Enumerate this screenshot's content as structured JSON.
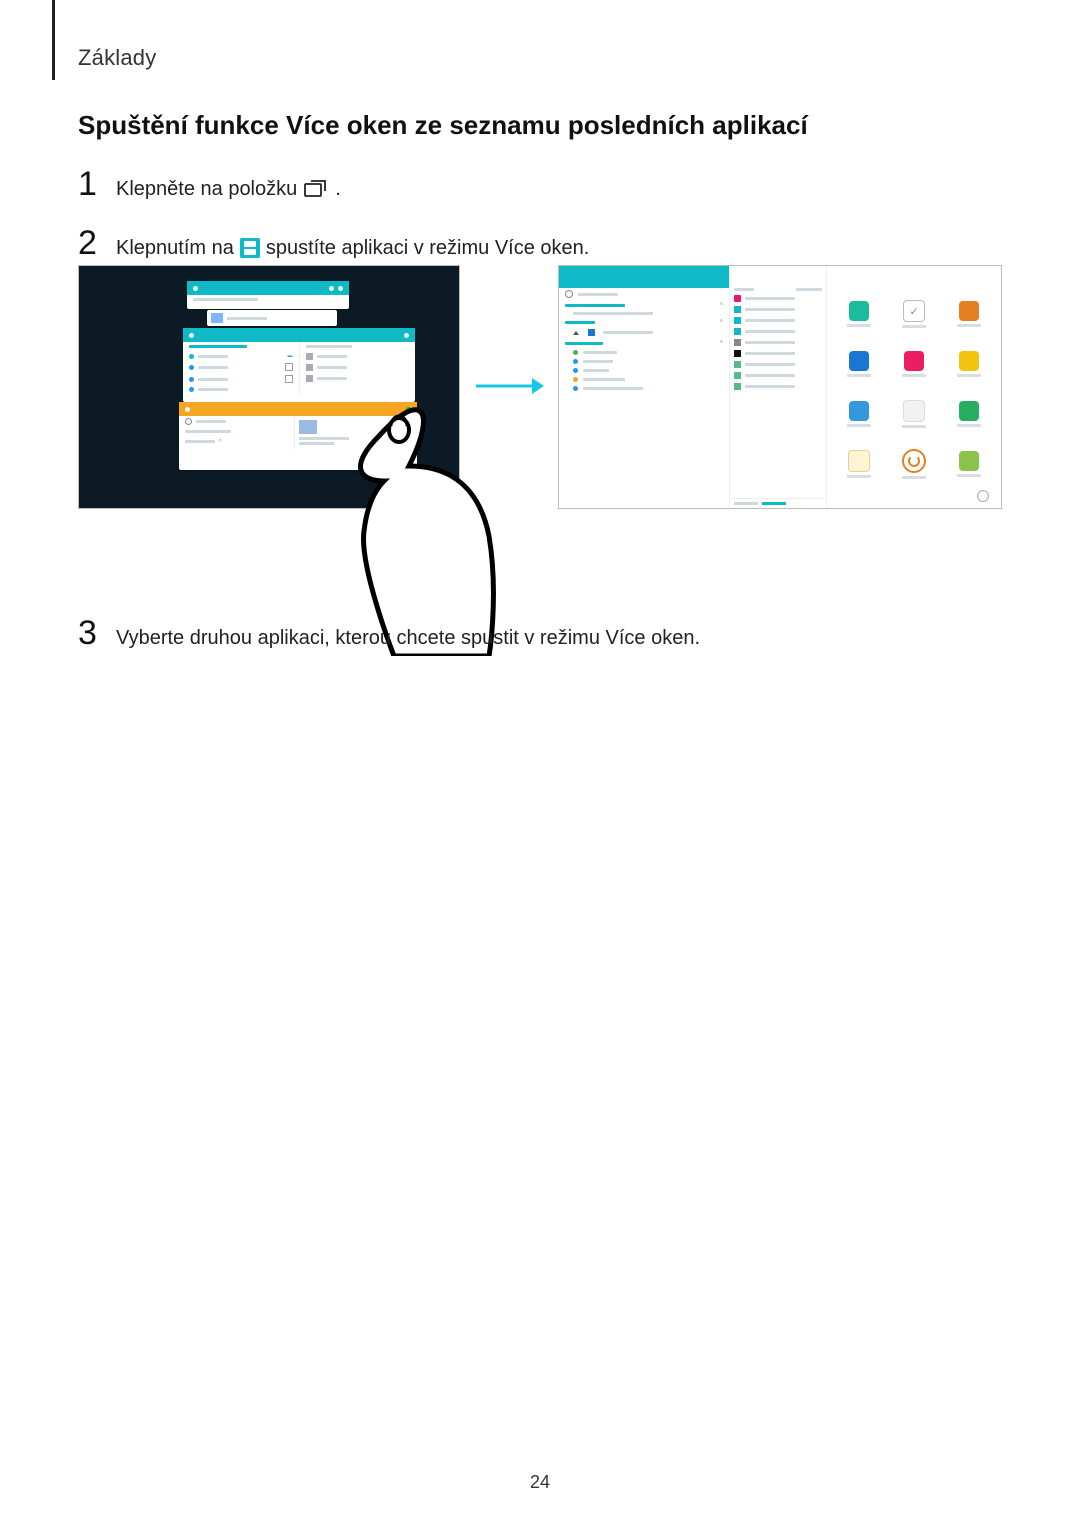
{
  "header": {
    "section_label": "Základy"
  },
  "title": "Spuštění funkce Více oken ze seznamu posledních aplikací",
  "steps": {
    "s1": {
      "num": "1",
      "text_before": "Klepněte na položku",
      "text_after": ".",
      "icon": "recent-apps-icon"
    },
    "s2": {
      "num": "2",
      "text_before": "Klepnutím na",
      "text_after": "spustíte aplikaci v režimu Více oken.",
      "icon": "split-window-icon"
    },
    "s3": {
      "num": "3",
      "text": "Vyberte druhou aplikaci, kterou chcete spustit v režimu Více oken."
    }
  },
  "figure": {
    "arrow_color": "#17c7e8",
    "light_tablet_apps": [
      {
        "color": "#1abc9c",
        "shape": "square"
      },
      {
        "color": "#bdc3c7",
        "shape": "clock"
      },
      {
        "color": "#e67e22",
        "shape": "contact"
      },
      {
        "color": "#1976d2",
        "shape": "down"
      },
      {
        "color": "#e91e63",
        "shape": "dot"
      },
      {
        "color": "#f1c40f",
        "shape": "gallery"
      },
      {
        "color": "#3498db",
        "shape": "globe"
      },
      {
        "color": "#ecf0f1",
        "shape": "blank"
      },
      {
        "color": "#27ae60",
        "shape": "maps"
      },
      {
        "color": "#ecf0f1",
        "shape": "folder"
      },
      {
        "color": "#e67e22",
        "shape": "head"
      },
      {
        "color": "#8bc34a",
        "shape": "leaf"
      }
    ]
  },
  "page_number": "24"
}
